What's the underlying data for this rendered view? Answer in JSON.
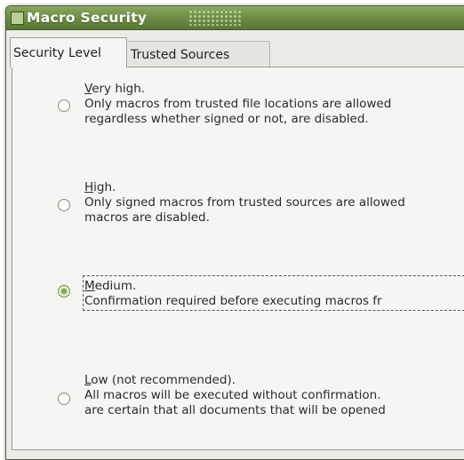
{
  "window": {
    "title": "Macro Security"
  },
  "tabs": [
    {
      "label": "Security Level",
      "active": true
    },
    {
      "label": "Trusted Sources",
      "active": false
    }
  ],
  "options": [
    {
      "title_accel": "V",
      "title_rest": "ery high.",
      "line1": "Only macros from trusted file locations are allowed",
      "line2": "regardless whether signed or not, are disabled.",
      "checked": false
    },
    {
      "title_accel": "H",
      "title_rest": "igh.",
      "line1": "Only signed macros from trusted sources are allowed",
      "line2": "macros are disabled.",
      "checked": false
    },
    {
      "title_accel": "M",
      "title_rest": "edium.",
      "line1": "Confirmation required before executing macros fr",
      "line2": "",
      "checked": true
    },
    {
      "title_accel": "L",
      "title_rest": "ow (not recommended).",
      "line1": "All macros will be executed without confirmation.",
      "line2": "are certain that all documents that will be opened",
      "checked": false
    }
  ],
  "colors": {
    "titlebar": "#6b8a43",
    "accent": "#7ea34f"
  }
}
